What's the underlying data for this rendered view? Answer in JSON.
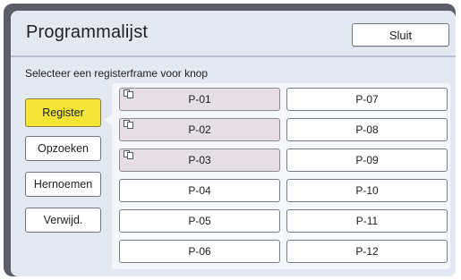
{
  "window": {
    "title": "Programmalijst",
    "close_label": "Sluit"
  },
  "instruction": "Selecteer een registerframe voor knop",
  "side_buttons": [
    {
      "label": "Register",
      "active": true
    },
    {
      "label": "Opzoeken",
      "active": false
    },
    {
      "label": "Hernoemen",
      "active": false
    },
    {
      "label": "Verwijd.",
      "active": false
    }
  ],
  "slots": [
    {
      "label": "P-01",
      "filled": true,
      "icon": "program-copy-icon"
    },
    {
      "label": "P-02",
      "filled": true,
      "icon": "program-copy-icon"
    },
    {
      "label": "P-03",
      "filled": true,
      "icon": "program-copy-icon"
    },
    {
      "label": "P-04",
      "filled": false
    },
    {
      "label": "P-05",
      "filled": false
    },
    {
      "label": "P-06",
      "filled": false
    },
    {
      "label": "P-07",
      "filled": false
    },
    {
      "label": "P-08",
      "filled": false
    },
    {
      "label": "P-09",
      "filled": false
    },
    {
      "label": "P-10",
      "filled": false
    },
    {
      "label": "P-11",
      "filled": false
    },
    {
      "label": "P-12",
      "filled": false
    }
  ],
  "colors": {
    "frame": "#5b5e66",
    "panel_background": "#e3e8f1",
    "active_button": "#f5e537",
    "filled_slot": "#e5dfe4"
  }
}
